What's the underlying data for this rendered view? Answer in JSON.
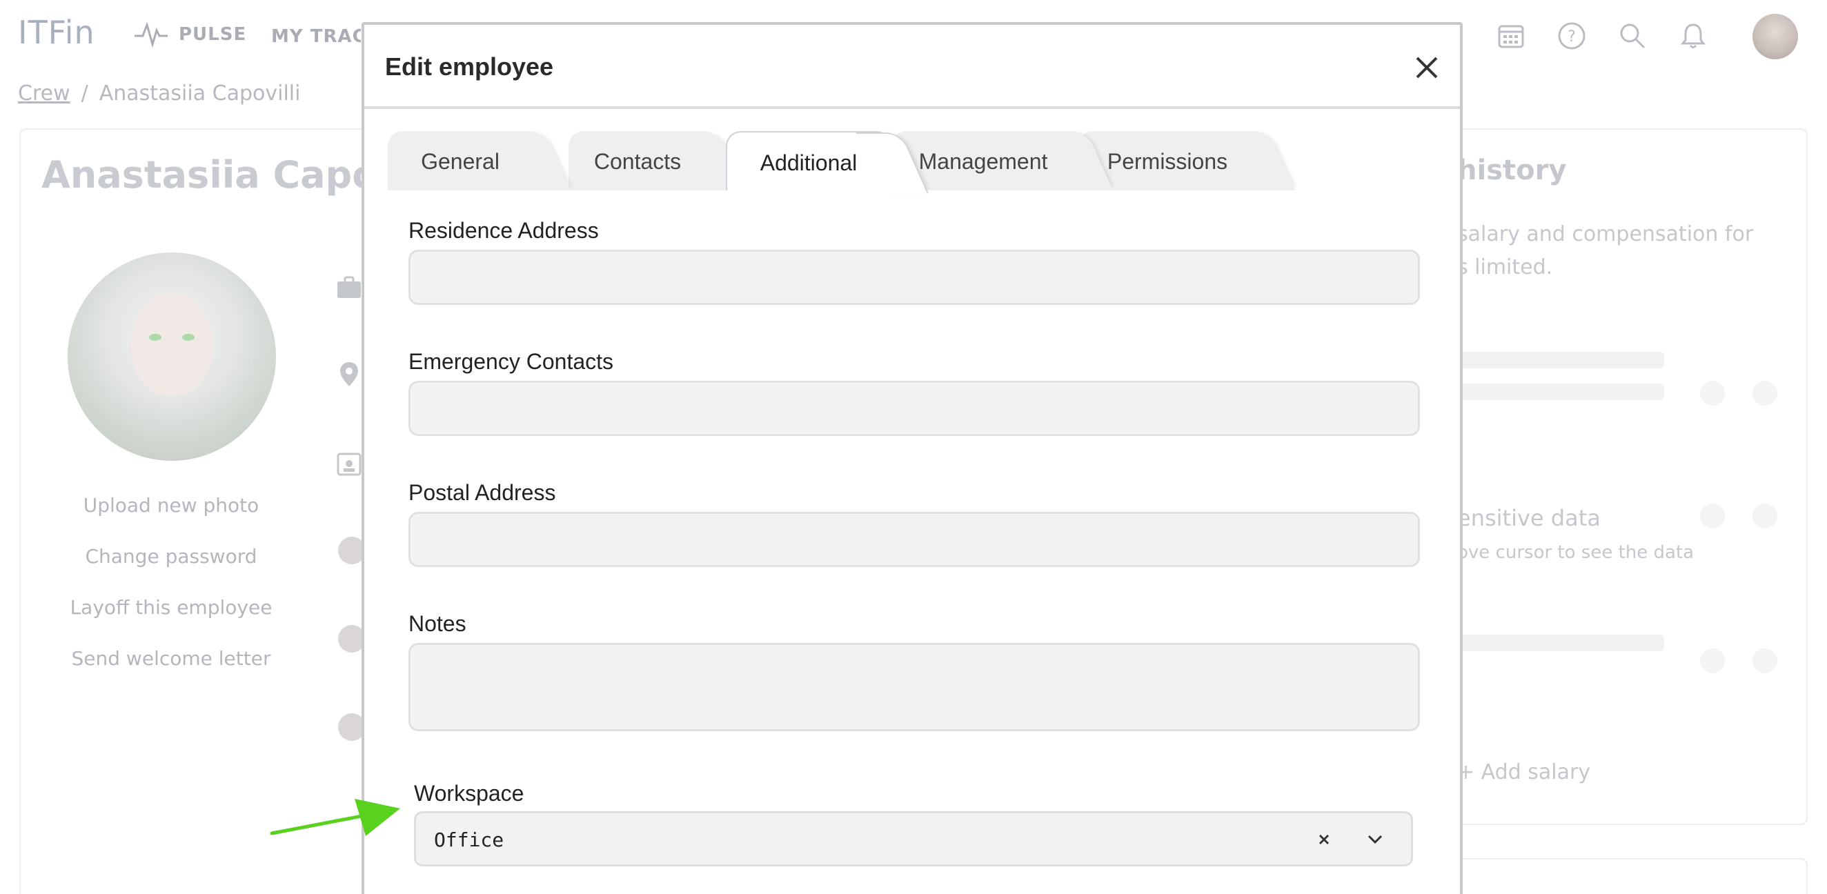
{
  "app": {
    "logo": "ITFin",
    "nav": {
      "pulse": "PULSE",
      "tracker": "MY TRACKER"
    },
    "breadcrumb": {
      "root": "Crew",
      "separator": "/",
      "current": "Anastasiia Capovilli"
    },
    "employee_name": "Anastasiia Capovilli",
    "side_links": [
      "Upload new photo",
      "Change password",
      "Layoff this employee",
      "Send welcome letter"
    ],
    "right_panel": {
      "title": "history",
      "description": "salary and compensation for s limited.",
      "sensitive_title": "ensitive data",
      "sensitive_sub": "ove cursor to see the data",
      "add_salary": "+  Add salary"
    }
  },
  "modal": {
    "title": "Edit employee",
    "tabs": [
      {
        "label": "General",
        "active": false
      },
      {
        "label": "Contacts",
        "active": false
      },
      {
        "label": "Additional",
        "active": true
      },
      {
        "label": "Management",
        "active": false
      },
      {
        "label": "Permissions",
        "active": false
      }
    ],
    "fields": {
      "residence_address": {
        "label": "Residence Address",
        "value": ""
      },
      "emergency_contacts": {
        "label": "Emergency Contacts",
        "value": ""
      },
      "postal_address": {
        "label": "Postal Address",
        "value": ""
      },
      "notes": {
        "label": "Notes",
        "value": ""
      },
      "workspace": {
        "label": "Workspace",
        "value": "Office"
      }
    }
  },
  "icons": {
    "close": "close-icon",
    "clear": "clear-icon",
    "chevron": "chevron-down-icon",
    "arrow": "arrow-annotation"
  },
  "colors": {
    "annotation_arrow": "#5ad11e",
    "input_background": "#f2f2f2"
  }
}
